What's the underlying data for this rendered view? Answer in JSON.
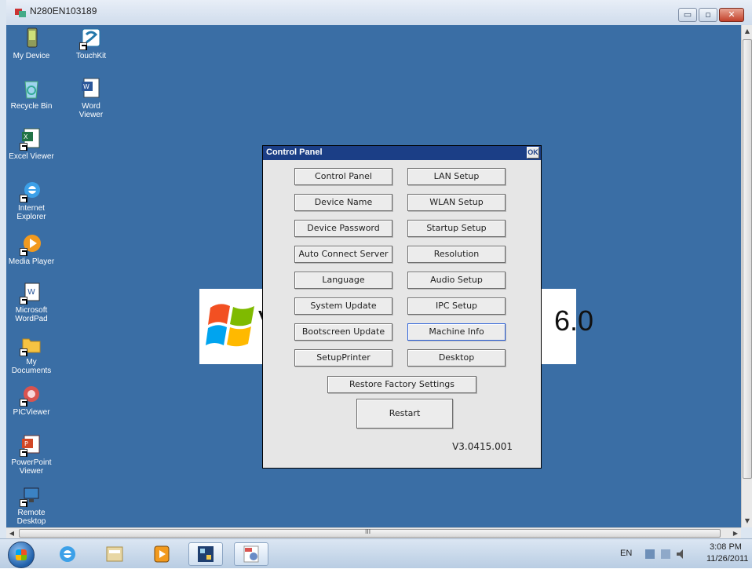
{
  "window": {
    "title": "N280EN103189",
    "controls": {
      "minimize": "▭",
      "maximize": "▫",
      "close": "✕"
    }
  },
  "desktop_icons": [
    {
      "id": "my-device",
      "label": "My Device",
      "icon": "device-icon"
    },
    {
      "id": "touchkit",
      "label": "TouchKit",
      "icon": "touchkit-icon"
    },
    {
      "id": "recycle-bin",
      "label": "Recycle Bin",
      "icon": "recycle-bin-icon"
    },
    {
      "id": "word-viewer",
      "label": "Word\nViewer",
      "icon": "word-viewer-icon"
    },
    {
      "id": "excel-viewer",
      "label": "Excel Viewer",
      "icon": "excel-viewer-icon"
    },
    {
      "id": "internet-explorer",
      "label": "Internet\nExplorer",
      "icon": "internet-explorer-icon"
    },
    {
      "id": "media-player",
      "label": "Media Player",
      "icon": "media-player-icon"
    },
    {
      "id": "wordpad",
      "label": "Microsoft\nWordPad",
      "icon": "wordpad-icon"
    },
    {
      "id": "my-documents",
      "label": "My\nDocuments",
      "icon": "folder-icon"
    },
    {
      "id": "picviewer",
      "label": "PICViewer",
      "icon": "picviewer-icon"
    },
    {
      "id": "powerpoint-viewer",
      "label": "PowerPoint\nViewer",
      "icon": "powerpoint-icon"
    },
    {
      "id": "remote-desktop",
      "label": "Remote\nDesktop",
      "icon": "remote-desktop-icon"
    }
  ],
  "background_logo": {
    "left_text": "V",
    "right_text": "6.0"
  },
  "dialog": {
    "title": "Control Panel",
    "ok_label": "OK",
    "buttons": [
      "Control Panel",
      "LAN Setup",
      "Device Name",
      "WLAN Setup",
      "Device Password",
      "Startup Setup",
      "Auto Connect Server",
      "Resolution",
      "Language",
      "Audio Setup",
      "System Update",
      "IPC Setup",
      "Bootscreen Update",
      "Machine Info",
      "SetupPrinter",
      "Desktop"
    ],
    "restore_label": "Restore Factory Settings",
    "restart_label": "Restart",
    "version": "V3.0415.001"
  },
  "scrollbars": {
    "grip": "III"
  },
  "taskbar": {
    "items": [
      "internet-explorer-icon",
      "file-manager-icon",
      "media-player-icon",
      "remote-app-icon",
      "ipc-tool-icon"
    ],
    "tray": {
      "lang": "EN",
      "time": "3:08 PM",
      "date": "11/26/2011"
    }
  },
  "colors": {
    "desktop": "#3a6ea5",
    "dialog_title": "#1b3e86",
    "dialog_bg": "#e6e6e6"
  }
}
